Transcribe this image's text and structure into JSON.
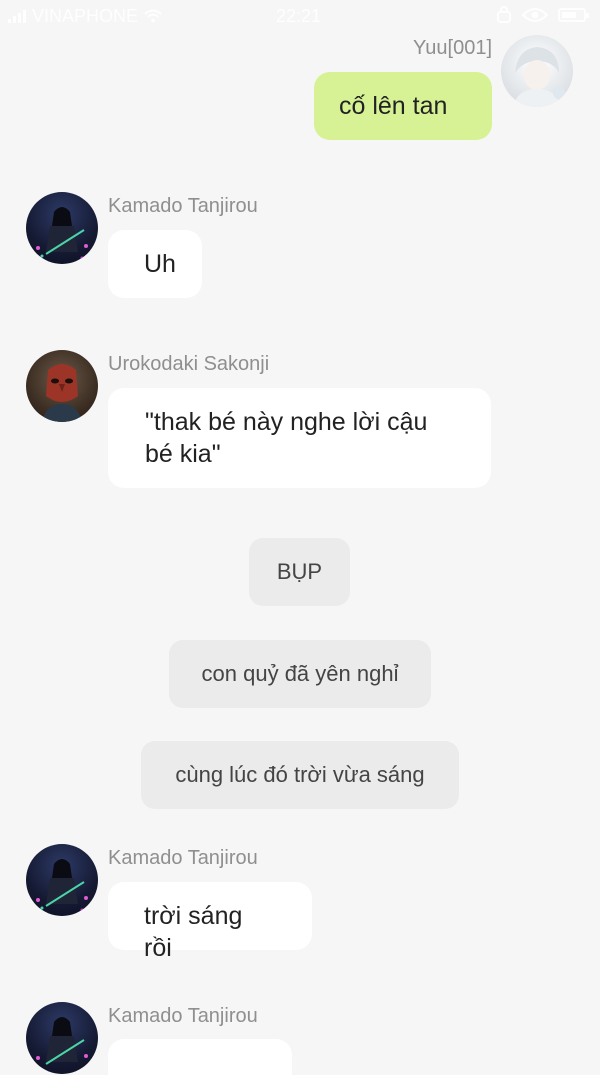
{
  "status_bar": {
    "carrier": "VINAPHONE",
    "time": "22:21",
    "wifi_icon": "wifi-icon",
    "battery_level": 0.7
  },
  "messages": [
    {
      "sender": "Yuu[001]",
      "text": "cố lên tan",
      "side": "right"
    },
    {
      "sender": "Kamado Tanjirou",
      "text": "Uh",
      "side": "left"
    },
    {
      "sender": "Urokodaki Sakonji",
      "text": "\"thak bé này nghe lời cậu bé kia\"",
      "side": "left"
    },
    {
      "sender": "Kamado Tanjirou",
      "text": "trời sáng rồi",
      "side": "left"
    },
    {
      "sender": "Kamado Tanjirou",
      "text": "",
      "side": "left"
    }
  ],
  "system_messages": [
    "BỤP",
    "con quỷ đã yên nghỉ",
    "cùng lúc đó trời vừa sáng"
  ],
  "colors": {
    "background": "#f6f6f6",
    "my_bubble": "#d6f295",
    "other_bubble": "#ffffff",
    "system_bubble": "#ebebeb",
    "name_text": "#8f8f8f"
  }
}
